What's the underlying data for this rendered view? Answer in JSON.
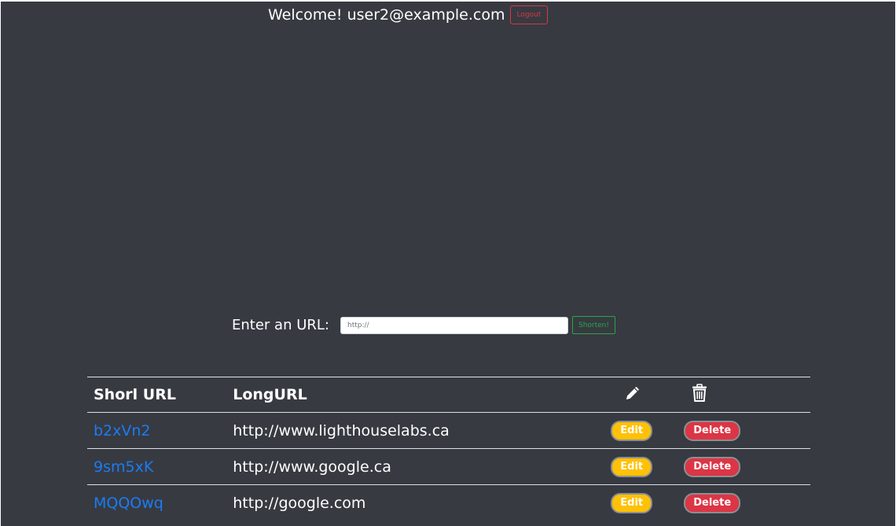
{
  "header": {
    "welcome_text": "Welcome! user2@example.com",
    "logout_label": "Logout"
  },
  "form": {
    "label": "Enter an URL:",
    "input_placeholder": "http://",
    "input_value": "",
    "submit_label": "Shorten!"
  },
  "table": {
    "headers": {
      "short": "Shorl URL",
      "long": "LongURL",
      "edit_icon": "pencil-icon",
      "delete_icon": "trash-icon"
    },
    "rows": [
      {
        "short": "b2xVn2",
        "long": "http://www.lighthouselabs.ca",
        "edit": "Edit",
        "delete": "Delete"
      },
      {
        "short": "9sm5xK",
        "long": "http://www.google.ca",
        "edit": "Edit",
        "delete": "Delete"
      },
      {
        "short": "MQQOwq",
        "long": "http://google.com",
        "edit": "Edit",
        "delete": "Delete"
      }
    ]
  },
  "colors": {
    "background": "#373a41",
    "link": "#1a7cf5",
    "edit": "#ffc107",
    "delete": "#dc3545",
    "shorten": "#28a745"
  }
}
